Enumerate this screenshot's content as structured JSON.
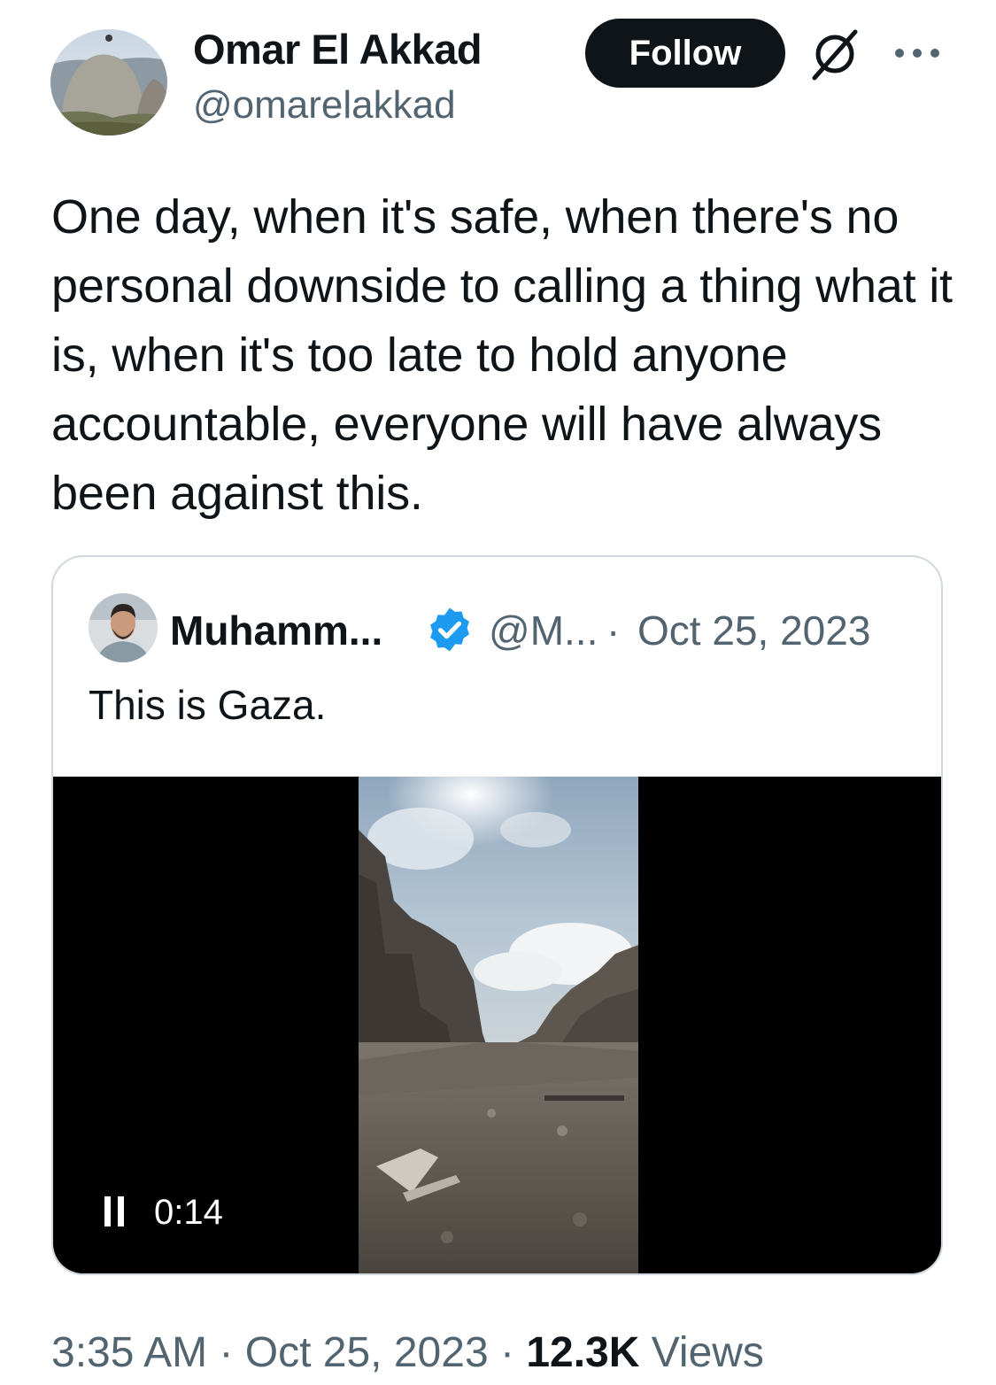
{
  "author": {
    "name": "Omar El Akkad",
    "handle": "@omarelakkad"
  },
  "header": {
    "follow_label": "Follow",
    "grok_icon": "grok-icon",
    "more_icon": "more-icon"
  },
  "tweet": {
    "text": "One day, when it's safe, when there's no personal downside to calling a thing what it is, when it's too late to hold anyone accountable, everyone will have always been against this."
  },
  "quoted_tweet": {
    "name": "Muhamm...",
    "verified": true,
    "handle": "@M...",
    "separator": "·",
    "date": "Oct 25, 2023",
    "text": "This is Gaza.",
    "video": {
      "pause_icon": "pause-icon",
      "timecode": "0:14"
    }
  },
  "meta": {
    "time": "3:35 AM",
    "separator": "·",
    "date": "Oct 25, 2023",
    "views_count": "12.3K",
    "views_label": "Views"
  },
  "colors": {
    "text": "#0f1419",
    "secondary": "#536471",
    "border": "#cfd9de",
    "verified": "#1d9bf0",
    "button": "#0f1419"
  }
}
